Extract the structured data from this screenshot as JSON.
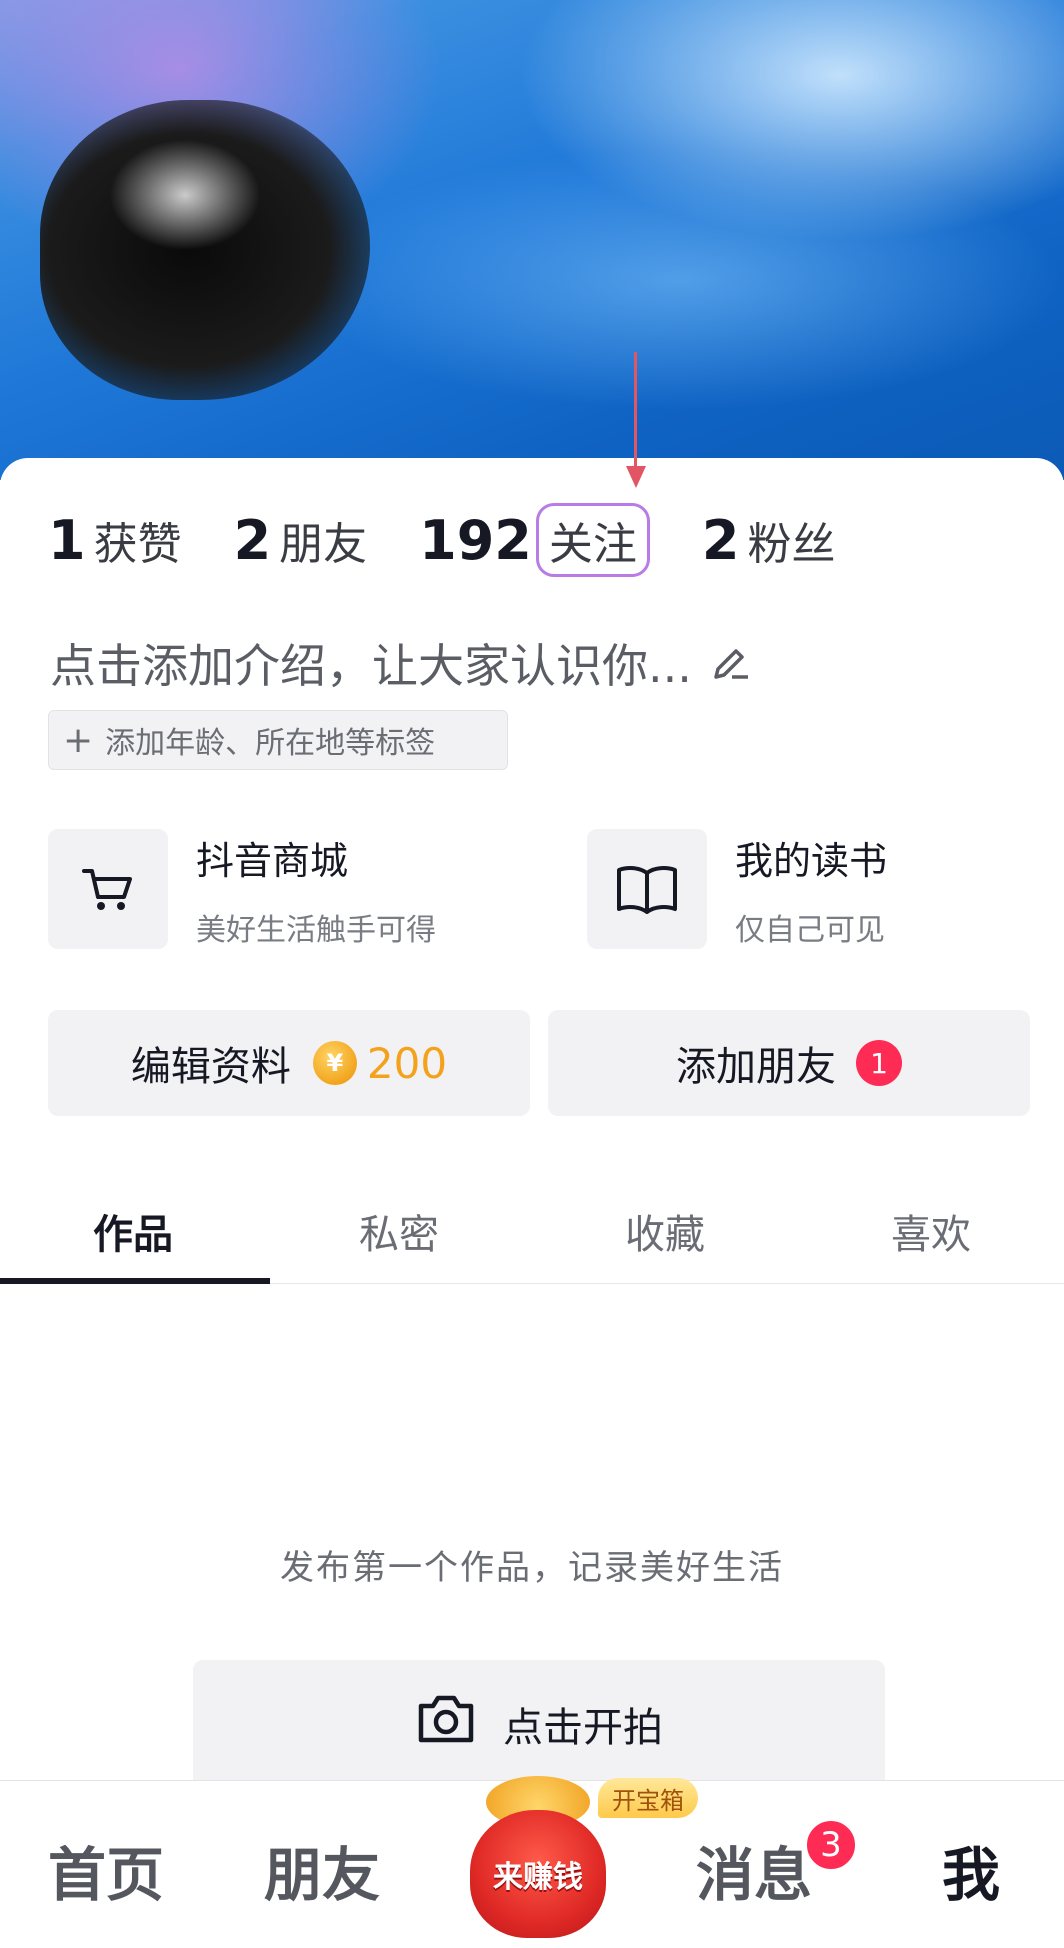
{
  "stats": [
    {
      "num": "1",
      "label": "获赞"
    },
    {
      "num": "2",
      "label": "朋友"
    },
    {
      "num": "192",
      "label": "关注"
    },
    {
      "num": "2",
      "label": "粉丝"
    }
  ],
  "bio": {
    "placeholder": "点击添加介绍，让大家认识你..."
  },
  "tag_button": {
    "label": "添加年龄、所在地等标签"
  },
  "cards": [
    {
      "title": "抖音商城",
      "subtitle": "美好生活触手可得"
    },
    {
      "title": "我的读书",
      "subtitle": "仅自己可见"
    }
  ],
  "actions": {
    "edit_label": "编辑资料",
    "coin_symbol": "¥",
    "coin_value": "200",
    "add_friend_label": "添加朋友",
    "add_friend_badge": "1"
  },
  "tabs": [
    "作品",
    "私密",
    "收藏",
    "喜欢"
  ],
  "empty": {
    "message": "发布第一个作品，记录美好生活",
    "shoot_label": "点击开拍"
  },
  "bottom_nav": {
    "home": "首页",
    "friends": "朋友",
    "earn": "来赚钱",
    "chest": "开宝箱",
    "messages": "消息",
    "messages_badge": "3",
    "me": "我"
  },
  "colors": {
    "accent_red": "#fe2c55",
    "coin_orange": "#f4a21c",
    "highlight_purple": "#b97be6",
    "arrow_red": "#e15565"
  }
}
